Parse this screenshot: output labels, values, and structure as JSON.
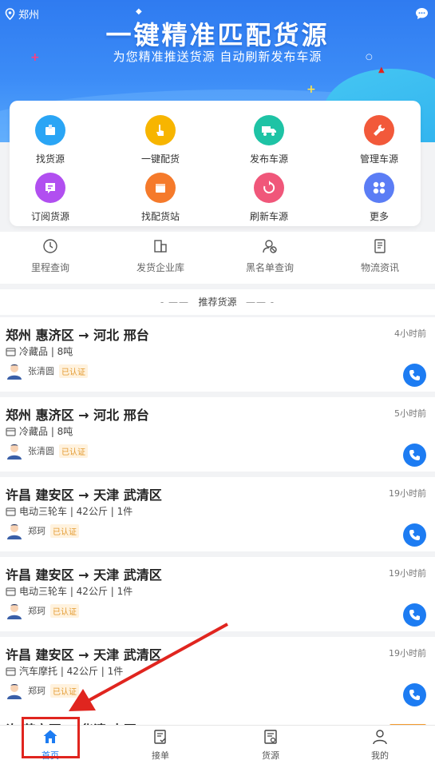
{
  "header": {
    "location": "郑州",
    "headline": "一键精准匹配货源",
    "subline": "为您精准推送货源 自动刷新发布车源",
    "location_icon": "location-pin-icon",
    "chat_icon": "chat-bubble-icon"
  },
  "menu": {
    "items": [
      {
        "label": "找货源",
        "icon": "find-cargo-icon",
        "color": "#2aa5f5"
      },
      {
        "label": "一键配货",
        "icon": "one-click-match-icon",
        "color": "#f7b500"
      },
      {
        "label": "发布车源",
        "icon": "truck-icon",
        "color": "#1ec3a5"
      },
      {
        "label": "管理车源",
        "icon": "manage-wrench-icon",
        "color": "#f2593a"
      },
      {
        "label": "订阅货源",
        "icon": "subscribe-icon",
        "color": "#b14ff0"
      },
      {
        "label": "找配货站",
        "icon": "station-icon",
        "color": "#f57a2b"
      },
      {
        "label": "刷新车源",
        "icon": "refresh-icon",
        "color": "#f0577a"
      },
      {
        "label": "更多",
        "icon": "more-grid-icon",
        "color": "#5b7df5"
      }
    ]
  },
  "tools": {
    "items": [
      {
        "label": "里程查询",
        "icon": "mileage-icon"
      },
      {
        "label": "发货企业库",
        "icon": "company-icon"
      },
      {
        "label": "黑名单查询",
        "icon": "blacklist-icon"
      },
      {
        "label": "物流资讯",
        "icon": "news-icon"
      }
    ]
  },
  "section": {
    "title": "推荐货源",
    "left_deco": "- ——",
    "right_deco": "—— -"
  },
  "listings": [
    {
      "route": "郑州 惠济区 → 河北 邢台",
      "time": "4小时前",
      "goods": "冷藏品 | 8吨",
      "user": "张清圆",
      "badge": "已认证"
    },
    {
      "route": "郑州 惠济区 → 河北 邢台",
      "time": "5小时前",
      "goods": "冷藏品 | 8吨",
      "user": "张清圆",
      "badge": "已认证"
    },
    {
      "route": "许昌 建安区 → 天津 武清区",
      "time": "19小时前",
      "goods": "电动三轮车 | 42公斤 | 1件",
      "user": "郑珂",
      "badge": "已认证"
    },
    {
      "route": "许昌 建安区 → 天津 武清区",
      "time": "19小时前",
      "goods": "电动三轮车 | 42公斤 | 1件",
      "user": "郑珂",
      "badge": "已认证"
    },
    {
      "route": "许昌 建安区 → 天津 武清区",
      "time": "19小时前",
      "goods": "汽车摩托 | 42公斤 | 1件",
      "user": "郑珂",
      "badge": "已认证"
    }
  ],
  "peek": {
    "text": "许   营安区 → 华清 中区"
  },
  "tabbar": {
    "items": [
      {
        "label": "首页",
        "icon": "home-icon",
        "active": true
      },
      {
        "label": "接单",
        "icon": "order-icon",
        "active": false
      },
      {
        "label": "货源",
        "icon": "cargo-icon",
        "active": false
      },
      {
        "label": "我的",
        "icon": "profile-icon",
        "active": false
      }
    ]
  },
  "colors": {
    "brand_blue": "#1d7cf2",
    "highlight_red": "#e0251f",
    "badge_orange": "#e39a2f"
  }
}
